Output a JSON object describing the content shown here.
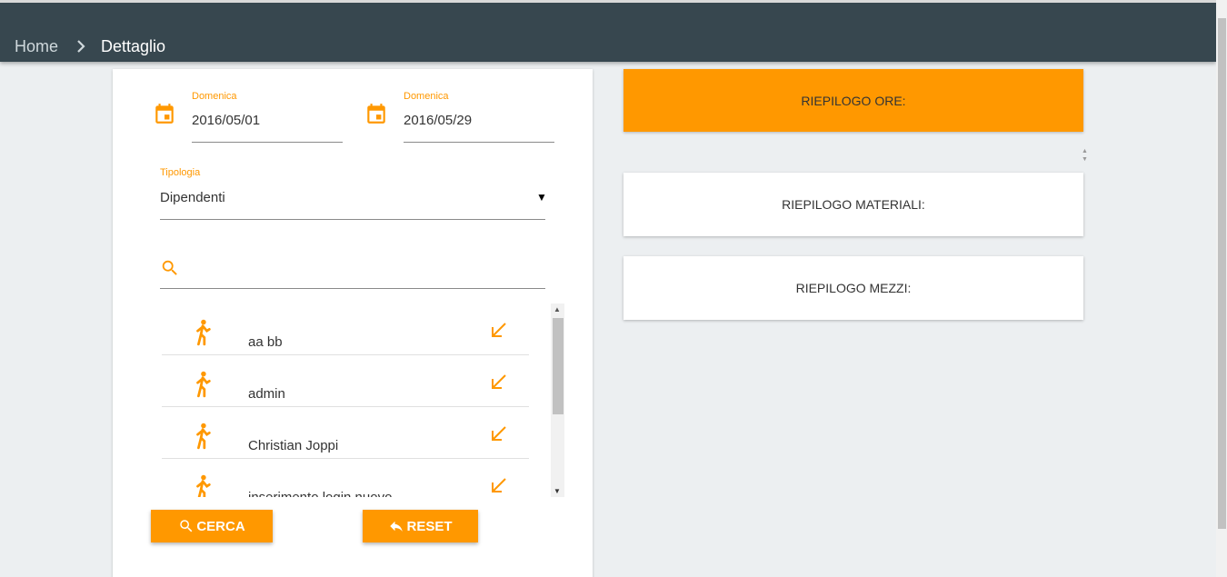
{
  "header": {
    "breadcrumb_home": "Home",
    "breadcrumb_separator_icon": "chevron-right-icon",
    "breadcrumb_current": "Dettaglio"
  },
  "filters": {
    "start_date": {
      "label": "Domenica",
      "value": "2016/05/01",
      "icon": "calendar-icon"
    },
    "end_date": {
      "label": "Domenica",
      "value": "2016/05/29",
      "icon": "calendar-icon"
    },
    "tipologia": {
      "label": "Tipologia",
      "value": "Dipendenti"
    },
    "search": {
      "value": "",
      "placeholder": "",
      "icon": "search-icon"
    }
  },
  "people": [
    {
      "name": "aa bb",
      "icon": "walking-person-icon",
      "action_icon": "arrow-down-left-icon"
    },
    {
      "name": "admin",
      "icon": "walking-person-icon",
      "action_icon": "arrow-down-left-icon"
    },
    {
      "name": "Christian Joppi",
      "icon": "walking-person-icon",
      "action_icon": "arrow-down-left-icon"
    },
    {
      "name": "inserimento login nuovo",
      "icon": "walking-person-icon",
      "action_icon": "arrow-down-left-icon"
    }
  ],
  "buttons": {
    "cerca": "CERCA",
    "reset": "RESET"
  },
  "summary": {
    "ore": "RIEPILOGO ORE:",
    "materiali": "RIEPILOGO MATERIALI:",
    "mezzi": "RIEPILOGO MEZZI:"
  },
  "colors": {
    "accent": "#ff9800",
    "header_bg": "#37474f",
    "page_bg": "#eceff1"
  }
}
